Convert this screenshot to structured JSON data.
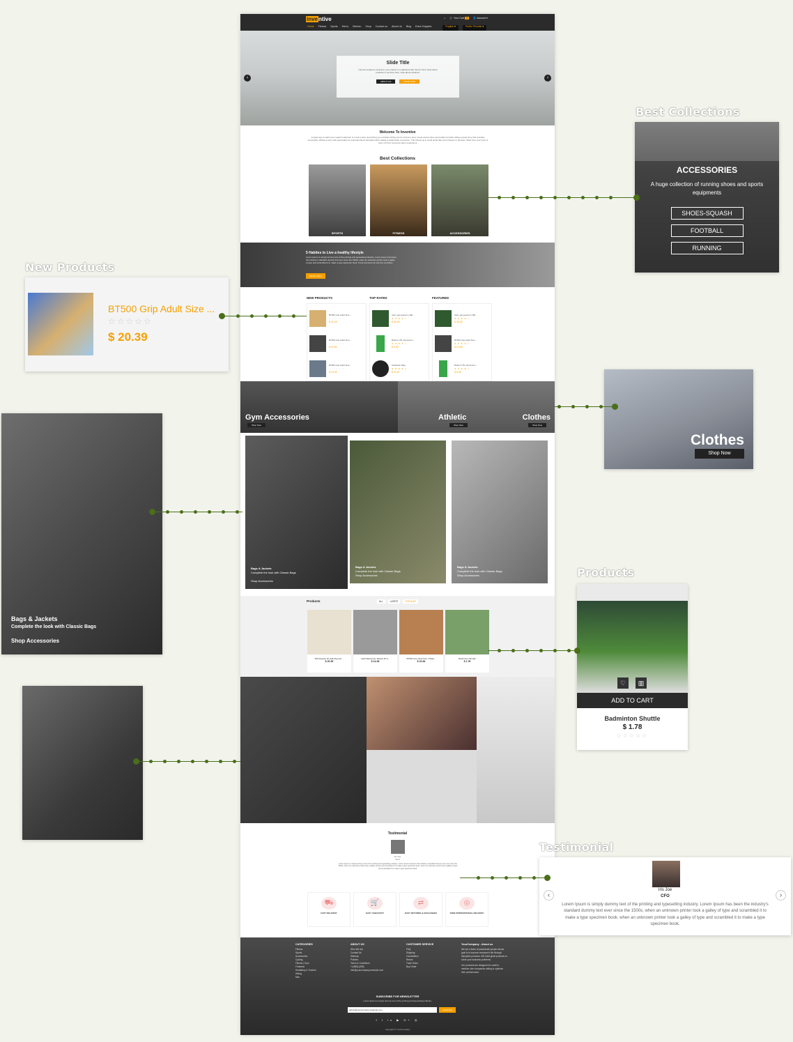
{
  "site": {
    "logo_a": "inve",
    "logo_b": "ntive",
    "nav": [
      "Home",
      "Fitness",
      "Sports",
      "Men's",
      "Women",
      "Shop",
      "Contact us",
      "About Us",
      "Blog",
      "Extra Snippets"
    ],
    "cart": "Your Cart",
    "cart_count": "0",
    "account": "Account",
    "lang": "English",
    "pricelist": "Public Pricelist"
  },
  "hero": {
    "title": "Slide Title",
    "text": "Use this snippet to welcome your product in a slideshow like format. Don't write about products or services here, write about solutions.",
    "btn1": "ABOUT US",
    "btn2": "SHOP NOW"
  },
  "welcome": {
    "title": "Welcome To Inventive",
    "text": "A great way to catch your reader's attention is to tell a story. Everything you consider writing can be told as a story. Great stories have personality.Consider telling a great story that provides personality. Writing a story with personality for potential clients will assist with making a relationship connection. This shows up in small quirks like word choices or phrases. Write from your point of view, not from someone else's experience."
  },
  "best_collections": {
    "title": "Best Collections",
    "items": [
      "SPORTS",
      "FITNESS",
      "ACCESSORIES"
    ]
  },
  "banner": {
    "title": "5 Habites to Live a healthy lifestyle",
    "text": "Lorem Ipsum is simply dummy text of the printing and typesetting industry. Lorem Ipsum has been the industry's standard dummy text ever since the 1500s, when an unknown printer took a galley of type and scrambled it to make a type specimen book. It has survived not only five centuries.",
    "btn": "Explore More"
  },
  "product_lists": [
    {
      "title": "NEW PRODUCTS",
      "items": [
        {
          "name": "BT500 Grip Adult Size ...",
          "price": "$ 20.39"
        },
        {
          "name": "BT500 Grip Adult Size ...",
          "price": "$ 22.84"
        },
        {
          "name": "BT500 Grip Adult Size ...",
          "price": "$ 15.30"
        }
      ]
    },
    {
      "title": "TOP RATED",
      "items": [
        {
          "name": "Astro gel quantum 180 ...",
          "price": "$ 30.59"
        },
        {
          "name": "Bottle 0.75L Aluminium...",
          "price": "$ 5.53"
        },
        {
          "name": "Kettlebell 10kg",
          "price": "$ 21.87"
        }
      ]
    },
    {
      "title": "FEATURED",
      "items": [
        {
          "name": "Astro gel quantum 180 ...",
          "price": "$ 30.59"
        },
        {
          "name": "BT500 Grip Adult Size ...",
          "price": "$ 22.84"
        },
        {
          "name": "Bottle 0.75L Aluminium...",
          "price": "$ 5.53"
        }
      ]
    }
  ],
  "categories": [
    {
      "title": "Gym Accessories",
      "btn": "Shop Now"
    },
    {
      "title": "Athletic",
      "btn": "Shop Now"
    },
    {
      "title": "Clothes",
      "btn": "Shop Now"
    }
  ],
  "bags": [
    {
      "title": "Bags & Jackets",
      "sub": "Complete the look with Classic Bags",
      "link": "Shop Accessories"
    },
    {
      "title": "Bags & Jackets",
      "sub": "Complete the look with Classic Bags",
      "link": "Shop Accessories"
    },
    {
      "title": "Bags & Jackets",
      "sub": "Complete the look with Classic Bags",
      "link": "Shop Accessories"
    }
  ],
  "products_section": {
    "title": "Products",
    "tabs": [
      "ALL",
      "LATEST",
      "POPULAR"
    ],
    "items": [
      {
        "name": "500 Regular Fit Half-Sleeved ...",
        "price": "$ 20.39"
      },
      {
        "name": "Adult Badminton Racket BI S...",
        "price": "$ 14.28"
      },
      {
        "name": "BT500 Grip Adult Size 7 Bask...",
        "price": "$ 22.84"
      },
      {
        "name": "Badminton Shuttle",
        "price": "$ 1.78"
      }
    ]
  },
  "testimonial": {
    "title": "Testimonial",
    "name": "Iris Joe",
    "role": "CFO",
    "text": "Lorem Ipsum is simply dummy text of the printing and typesetting industry. Lorem Ipsum has been the industry's standard dummy text ever since the 1500s, when an unknown printer took a galley of type and scrambled it to make a type specimen book. when an unknown printer took a galley of type and scrambled it to make a type specimen book."
  },
  "features": [
    "FAST DELIVERY",
    "EASY CHECKOUT",
    "EASY RETURNS & EXCHANGES",
    "FREE INTERNATIONAL DELIVERY"
  ],
  "footer": {
    "cols": [
      {
        "title": "CATEGORIES",
        "items": [
          "Fitness",
          "Sports",
          "Accessories",
          "Cycling",
          "Fitness | Gym",
          "Footwear",
          "Headlamp & Torches",
          "Hiking",
          "Men"
        ]
      },
      {
        "title": "ABOUT US",
        "items": [
          "Who We Are",
          "Contact Us",
          "Sitemap",
          "Policies",
          "Terms & Conditions",
          "+1(555)-(555)",
          "info@yourcompany.example.com"
        ]
      },
      {
        "title": "CUSTOMER SERVICE",
        "items": [
          "FAQ",
          "Shipping",
          "Cancellation",
          "Return",
          "Track Order",
          "Buy Order"
        ]
      },
      {
        "title": "YourCompany - About us",
        "items": [
          "We are a team of passionate people whose goal is to improve everyone's life through disruptive products. We build great products to solve your business problems.",
          "Our products are designed for small to medium size companies willing to optimize their performance."
        ]
      }
    ],
    "newsletter_title": "SUBSCRIBE FOR NEWSLETTER",
    "newsletter_text": "Lorem Ipsum is simply dummy text of the printing and typesetting industry.",
    "email_value": "admin@yourcompany.example.com",
    "subscribe": "Subscribe",
    "copyright": "Copyright © YourCompany"
  },
  "callouts": {
    "best_collections": {
      "label": "Best Collections",
      "heading": "ACCESSORIES",
      "text": "A huge collection of running shoes and sports equipments",
      "buttons": [
        "SHOES-SQUASH",
        "FOOTBALL",
        "RUNNING"
      ]
    },
    "new_products": {
      "label": "New Products",
      "name": "BT500 Grip Adult Size ...",
      "price": "$ 20.39"
    },
    "clothes": {
      "title": "Clothes",
      "btn": "Shop Now"
    },
    "bags": {
      "title": "Bags & Jackets",
      "sub": "Complete the look with Classic Bags",
      "link": "Shop Accessories"
    },
    "products": {
      "label": "Products",
      "add_to_cart": "ADD TO CART",
      "name": "Badminton Shuttle",
      "price": "$ 1.78"
    },
    "testimonial": {
      "label": "Testimonial",
      "name": "Iris Joe",
      "role": "CFO",
      "text": "Lorem Ipsum is simply dummy text of the printing and typesetting industry. Lorem Ipsum has been the industry's standard dummy text ever since the 1500s, when an unknown printer took a galley of type and scrambled it to make a type specimen book. when an unknown printer took a galley of type and scrambled it to make a type specimen book."
    }
  },
  "colors": {
    "accent": "#f5a000",
    "connector": "#4a6e1a",
    "background": "#f2f4ec"
  }
}
